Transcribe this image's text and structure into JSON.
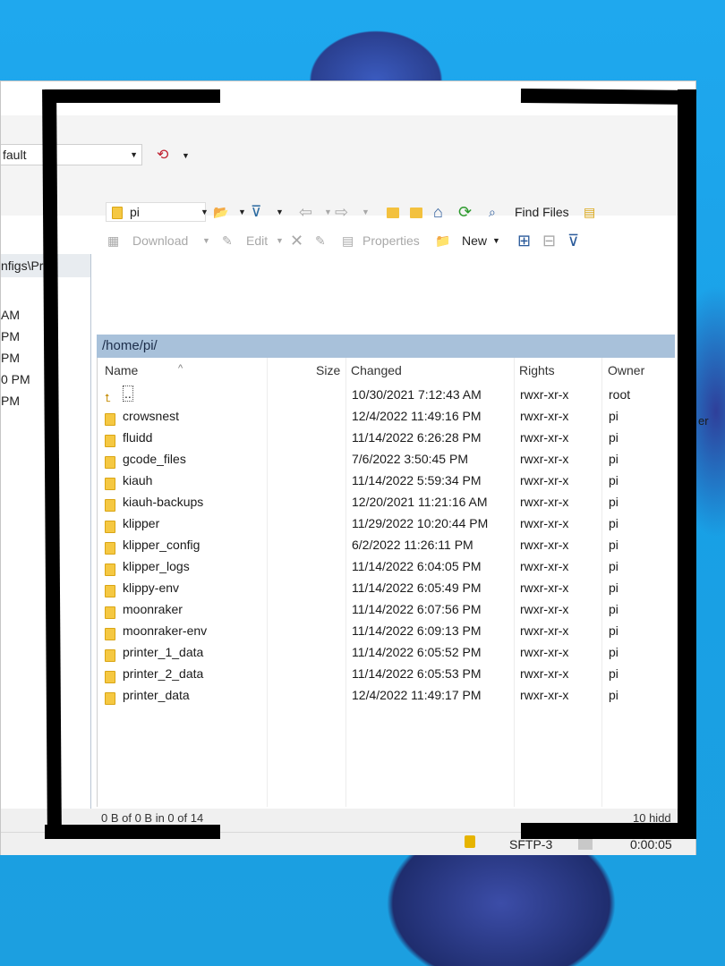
{
  "session": {
    "profile_value": "fault",
    "tool_icon": "sync-icon"
  },
  "left_panel": {
    "path": "nfigs\\Pri",
    "times": [
      "AM",
      "PM",
      "PM",
      "0 PM",
      "PM"
    ]
  },
  "toolbar": {
    "directory": "pi",
    "find_files": "Find Files",
    "download": "Download",
    "edit": "Edit",
    "properties": "Properties",
    "new": "New"
  },
  "path": "/home/pi/",
  "columns": {
    "name": "Name",
    "size": "Size",
    "changed": "Changed",
    "rights": "Rights",
    "owner": "Owner"
  },
  "files": [
    {
      "name": "..",
      "changed": "10/30/2021 7:12:43 AM",
      "rights": "rwxr-xr-x",
      "owner": "root",
      "parent": true
    },
    {
      "name": "crowsnest",
      "changed": "12/4/2022 11:49:16 PM",
      "rights": "rwxr-xr-x",
      "owner": "pi"
    },
    {
      "name": "fluidd",
      "changed": "11/14/2022 6:26:28 PM",
      "rights": "rwxr-xr-x",
      "owner": "pi"
    },
    {
      "name": "gcode_files",
      "changed": "7/6/2022 3:50:45 PM",
      "rights": "rwxr-xr-x",
      "owner": "pi"
    },
    {
      "name": "kiauh",
      "changed": "11/14/2022 5:59:34 PM",
      "rights": "rwxr-xr-x",
      "owner": "pi"
    },
    {
      "name": "kiauh-backups",
      "changed": "12/20/2021 11:21:16 AM",
      "rights": "rwxr-xr-x",
      "owner": "pi"
    },
    {
      "name": "klipper",
      "changed": "11/29/2022 10:20:44 PM",
      "rights": "rwxr-xr-x",
      "owner": "pi"
    },
    {
      "name": "klipper_config",
      "changed": "6/2/2022 11:26:11 PM",
      "rights": "rwxr-xr-x",
      "owner": "pi"
    },
    {
      "name": "klipper_logs",
      "changed": "11/14/2022 6:04:05 PM",
      "rights": "rwxr-xr-x",
      "owner": "pi"
    },
    {
      "name": "klippy-env",
      "changed": "11/14/2022 6:05:49 PM",
      "rights": "rwxr-xr-x",
      "owner": "pi"
    },
    {
      "name": "moonraker",
      "changed": "11/14/2022 6:07:56 PM",
      "rights": "rwxr-xr-x",
      "owner": "pi"
    },
    {
      "name": "moonraker-env",
      "changed": "11/14/2022 6:09:13 PM",
      "rights": "rwxr-xr-x",
      "owner": "pi"
    },
    {
      "name": "printer_1_data",
      "changed": "11/14/2022 6:05:52 PM",
      "rights": "rwxr-xr-x",
      "owner": "pi"
    },
    {
      "name": "printer_2_data",
      "changed": "11/14/2022 6:05:53 PM",
      "rights": "rwxr-xr-x",
      "owner": "pi"
    },
    {
      "name": "printer_data",
      "changed": "12/4/2022 11:49:17 PM",
      "rights": "rwxr-xr-x",
      "owner": "pi"
    }
  ],
  "status": {
    "selection": "0 B of 0 B in 0 of 14",
    "hidden": "10 hidd",
    "protocol": "SFTP-3",
    "elapsed": "0:00:05"
  },
  "desktop_text": "er"
}
